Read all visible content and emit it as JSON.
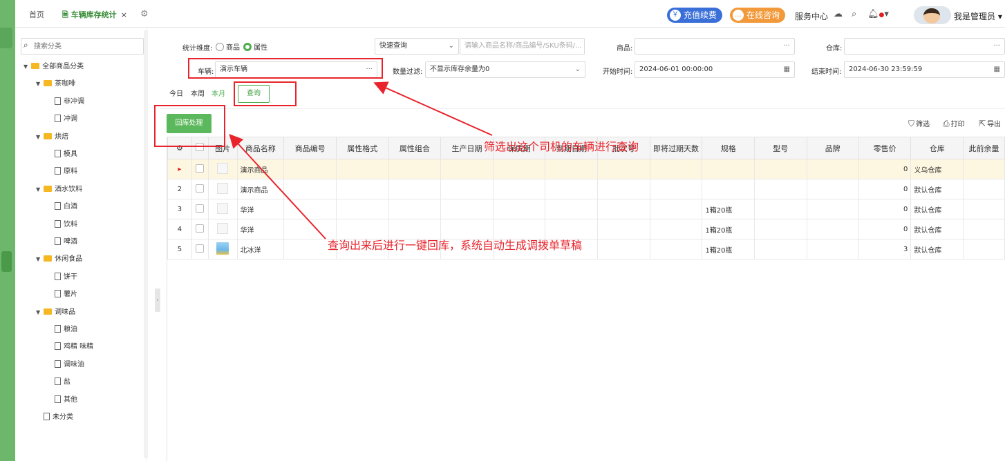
{
  "tabs": {
    "home": "首页",
    "active": "车辆库存统计",
    "close": "×"
  },
  "header": {
    "recharge": "充值续费",
    "consult": "在线咨询",
    "service": "服务中心",
    "user": "我是管理员"
  },
  "sidebar": {
    "search_placeholder": "搜索分类",
    "tree": [
      {
        "label": "全部商品分类",
        "type": "folder-root"
      },
      {
        "label": "茶咖啡",
        "type": "folder"
      },
      {
        "label": "非冲调",
        "type": "file"
      },
      {
        "label": "冲调",
        "type": "file"
      },
      {
        "label": "烘焙",
        "type": "folder"
      },
      {
        "label": "模具",
        "type": "file"
      },
      {
        "label": "原料",
        "type": "file"
      },
      {
        "label": "酒水饮料",
        "type": "folder"
      },
      {
        "label": "白酒",
        "type": "file"
      },
      {
        "label": "饮料",
        "type": "file"
      },
      {
        "label": "啤酒",
        "type": "file"
      },
      {
        "label": "休闲食品",
        "type": "folder"
      },
      {
        "label": "饼干",
        "type": "file"
      },
      {
        "label": "薯片",
        "type": "file"
      },
      {
        "label": "调味品",
        "type": "folder"
      },
      {
        "label": "粮油",
        "type": "file"
      },
      {
        "label": "鸡精 味精",
        "type": "file"
      },
      {
        "label": "调味油",
        "type": "file"
      },
      {
        "label": "盐",
        "type": "file"
      },
      {
        "label": "其他",
        "type": "file"
      },
      {
        "label": "未分类",
        "type": "file-root"
      }
    ]
  },
  "filters": {
    "dimension_label": "统计维度:",
    "dim_goods": "商品",
    "dim_attr": "属性",
    "quick_query": "快速查询",
    "search_placeholder": "请输入商品名称/商品编号/SKU条码/...",
    "goods_label": "商品:",
    "warehouse_label": "仓库:",
    "vehicle_label": "车辆:",
    "vehicle_value": "演示车辆",
    "qty_filter_label": "数量过滤:",
    "qty_filter_value": "不显示库存余量为0",
    "start_label": "开始时间:",
    "start_value": "2024-06-01 00:00:00",
    "end_label": "结束时间:",
    "end_value": "2024-06-30 23:59:59",
    "ellipsis": "···",
    "quick_today": "今日",
    "quick_week": "本周",
    "quick_month": "本月",
    "query_btn": "查询"
  },
  "toolbar": {
    "return_btn": "回库处理",
    "filter": "筛选",
    "print": "打印",
    "export": "导出"
  },
  "table": {
    "headers": [
      "",
      "",
      "图片",
      "商品名称",
      "商品编号",
      "属性格式",
      "属性组合",
      "生产日期",
      "保质期",
      "到期日期",
      "批次号",
      "即将过期天数",
      "规格",
      "型号",
      "品牌",
      "零售价",
      "仓库",
      "此前余量"
    ],
    "rows": [
      {
        "no": "▸",
        "name": "演示商品",
        "spec": "",
        "retail": "0",
        "warehouse": "义乌仓库"
      },
      {
        "no": "2",
        "name": "演示商品",
        "spec": "",
        "retail": "0",
        "warehouse": "默认仓库"
      },
      {
        "no": "3",
        "name": "华洋",
        "spec": "1箱20瓶",
        "retail": "0",
        "warehouse": "默认仓库"
      },
      {
        "no": "4",
        "name": "华洋",
        "spec": "1箱20瓶",
        "retail": "0",
        "warehouse": "默认仓库"
      },
      {
        "no": "5",
        "name": "北冰洋",
        "spec": "1箱20瓶",
        "retail": "3",
        "warehouse": "默认仓库"
      }
    ]
  },
  "annotations": {
    "a1": "筛选出这个司机的车辆进行查询",
    "a2": "查询出来后进行一键回库，系统自动生成调拨单草稿"
  },
  "colors": {
    "accent": "#4cae4c",
    "annotation": "#e8232b"
  }
}
